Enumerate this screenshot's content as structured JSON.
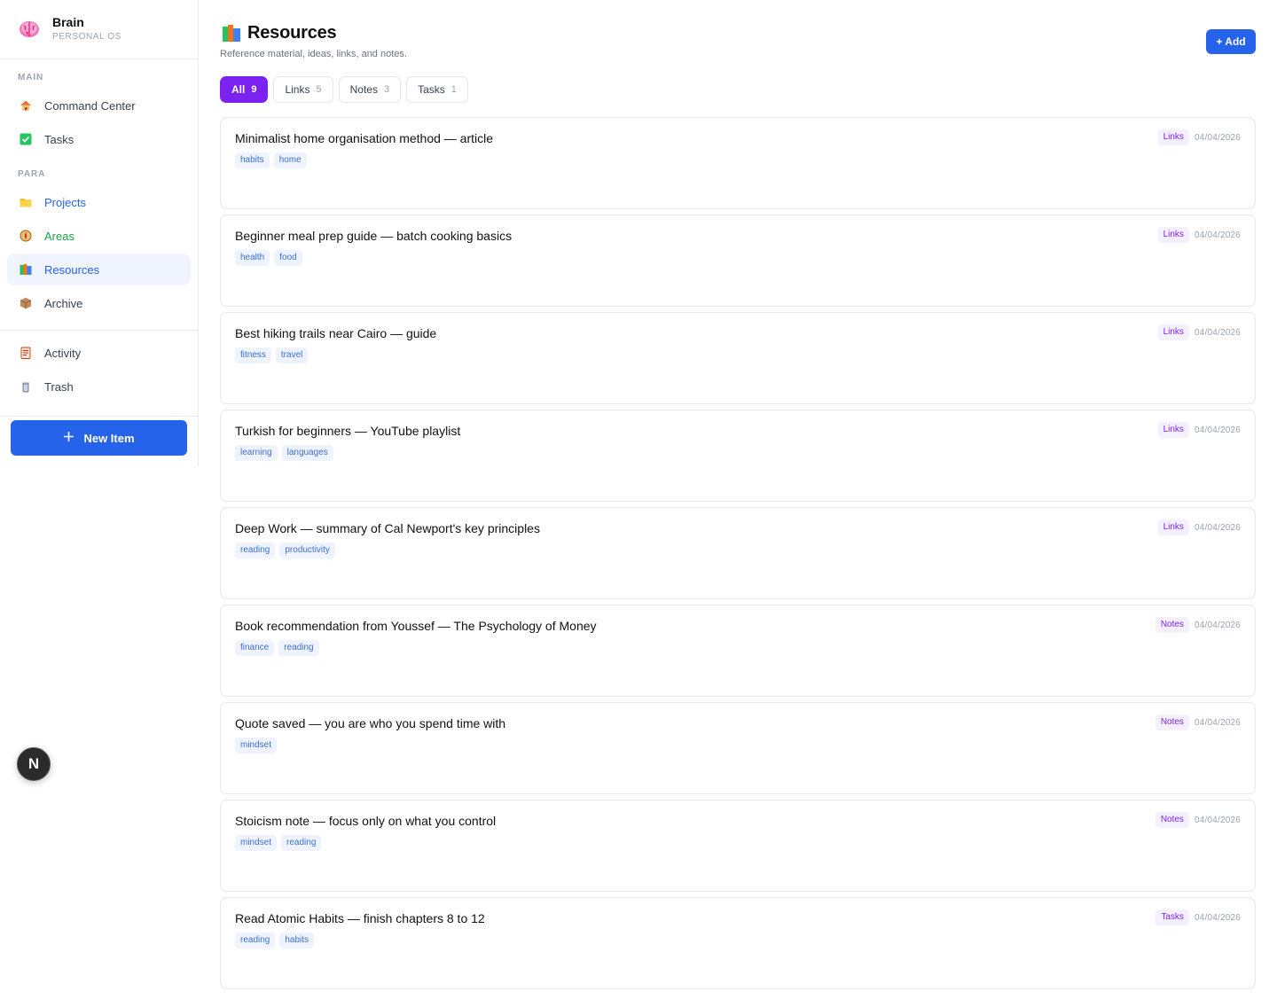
{
  "brand": {
    "name": "Brain",
    "subtitle": "PERSONAL OS",
    "icon": "brain-icon"
  },
  "sidebar": {
    "main_label": "MAIN",
    "main_items": [
      {
        "label": "Command Center",
        "icon": "house-icon"
      },
      {
        "label": "Tasks",
        "icon": "check-box-icon"
      }
    ],
    "para_label": "PARA",
    "para_items": [
      {
        "label": "Projects",
        "icon": "folder-icon"
      },
      {
        "label": "Areas",
        "icon": "compass-icon"
      },
      {
        "label": "Resources",
        "icon": "books-icon"
      },
      {
        "label": "Archive",
        "icon": "package-icon"
      }
    ],
    "other_items": [
      {
        "label": "Activity",
        "icon": "clipboard-icon"
      },
      {
        "label": "Trash",
        "icon": "trash-icon"
      }
    ],
    "new_item_label": "New Item"
  },
  "fab": {
    "label": "N"
  },
  "page": {
    "title": "Resources",
    "subtitle": "Reference material, ideas, links, and notes.",
    "add_label": "+ Add"
  },
  "filters": [
    {
      "label": "All",
      "count": "9"
    },
    {
      "label": "Links",
      "count": "5"
    },
    {
      "label": "Notes",
      "count": "3"
    },
    {
      "label": "Tasks",
      "count": "1"
    }
  ],
  "items": [
    {
      "title": "Minimalist home organisation method — article",
      "tags": [
        "habits",
        "home"
      ],
      "type": "Links",
      "date": "04/04/2026"
    },
    {
      "title": "Beginner meal prep guide — batch cooking basics",
      "tags": [
        "health",
        "food"
      ],
      "type": "Links",
      "date": "04/04/2026"
    },
    {
      "title": "Best hiking trails near Cairo — guide",
      "tags": [
        "fitness",
        "travel"
      ],
      "type": "Links",
      "date": "04/04/2026"
    },
    {
      "title": "Turkish for beginners — YouTube playlist",
      "tags": [
        "learning",
        "languages"
      ],
      "type": "Links",
      "date": "04/04/2026"
    },
    {
      "title": "Deep Work — summary of Cal Newport's key principles",
      "tags": [
        "reading",
        "productivity"
      ],
      "type": "Links",
      "date": "04/04/2026"
    },
    {
      "title": "Book recommendation from Youssef — The Psychology of Money",
      "tags": [
        "finance",
        "reading"
      ],
      "type": "Notes",
      "date": "04/04/2026"
    },
    {
      "title": "Quote saved — you are who you spend time with",
      "tags": [
        "mindset"
      ],
      "type": "Notes",
      "date": "04/04/2026"
    },
    {
      "title": "Stoicism note — focus only on what you control",
      "tags": [
        "mindset",
        "reading"
      ],
      "type": "Notes",
      "date": "04/04/2026"
    },
    {
      "title": "Read Atomic Habits — finish chapters 8 to 12",
      "tags": [
        "reading",
        "habits"
      ],
      "type": "Tasks",
      "date": "04/04/2026"
    }
  ],
  "colors": {
    "accent": "#2563eb",
    "filter_active": "#7c22f0",
    "tag_text": "#3b6fd4",
    "badge_text": "#7c22f0"
  }
}
